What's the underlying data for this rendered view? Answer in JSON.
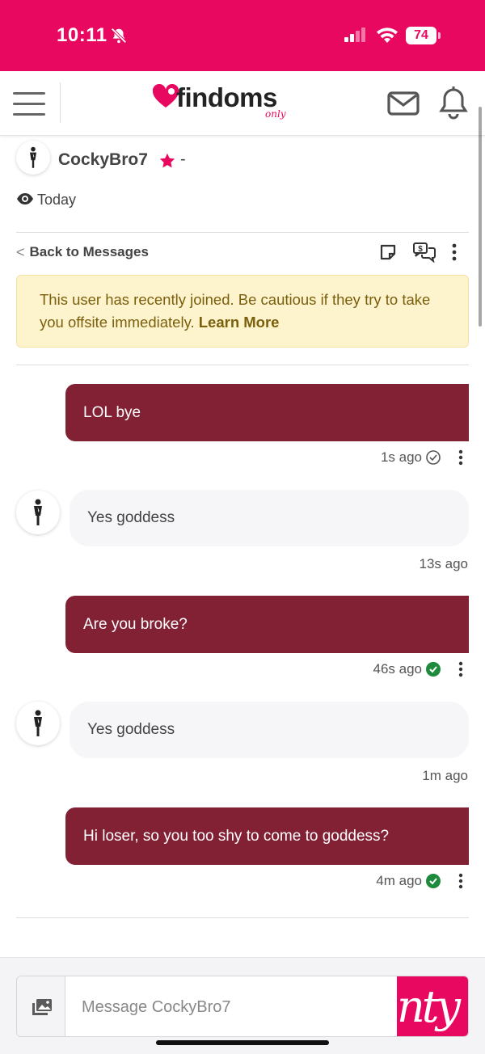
{
  "status_bar": {
    "time": "10:11",
    "battery": "74"
  },
  "header": {
    "logo_text": "findoms",
    "logo_sub": "only"
  },
  "profile": {
    "username": "CockyBro7",
    "separator": "-",
    "last_seen": "Today"
  },
  "toolbar": {
    "back_label": "Back to Messages",
    "back_chevron": "<"
  },
  "banner": {
    "text": "This user has recently joined. Be cautious if they try to take you offsite immediately.",
    "link": "Learn More"
  },
  "messages": [
    {
      "direction": "out",
      "text": "LOL bye",
      "time": "1s ago",
      "status": "sent"
    },
    {
      "direction": "in",
      "text": "Yes goddess",
      "time": "13s ago"
    },
    {
      "direction": "out",
      "text": "Are you broke?",
      "time": "46s ago",
      "status": "read"
    },
    {
      "direction": "in",
      "text": "Yes goddess",
      "time": "1m ago"
    },
    {
      "direction": "out",
      "text": "Hi loser, so you too shy to come to goddess?",
      "time": "4m ago",
      "status": "read"
    }
  ],
  "composer": {
    "placeholder": "Message CockyBro7",
    "send_label": "nty"
  },
  "colors": {
    "brand": "#e8085f",
    "outgoing_bubble": "#822134",
    "incoming_bubble": "#f6f6f8",
    "read_check": "#1e8a3c",
    "banner_bg": "#fdf3cd"
  }
}
